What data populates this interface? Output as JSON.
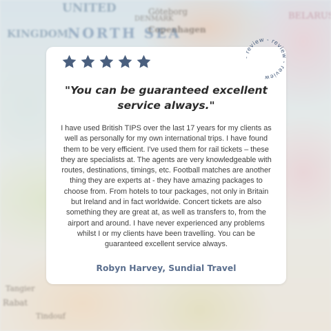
{
  "background": {
    "type": "map",
    "labels": [
      "UNITED",
      "KINGDOM",
      "NORTH SEA",
      "Göteborg",
      "Copenhagen",
      "DENMARK",
      "BELARUS",
      "Rabat",
      "Tangier",
      "Tindouf"
    ]
  },
  "rating": {
    "stars": 5,
    "max": 5,
    "color": "#4a5f7e"
  },
  "badge": {
    "text": "- review - review - review "
  },
  "review": {
    "quote": "\"You can be guaranteed excellent service always.\"",
    "body": "I have used British TIPS over the last 17 years for my clients as well as personally for my own international trips. I have found them to be very efficient. I've used them for rail tickets – these they are specialists at. The agents are very knowledgeable with routes, destinations, timings, etc. Football matches are another thing they are experts at - they have amazing packages to choose from. From hotels to tour packages, not only in Britain but Ireland and in fact worldwide. Concert tickets are also something they are great at, as well as transfers to, from the airport and around. I have never experienced any problems whilst I or my clients have been travelling. You can be guaranteed excellent service always.",
    "author": "Robyn Harvey, Sundial Travel"
  },
  "colors": {
    "accent": "#4a5f7e",
    "author": "#5b6f8e",
    "card": "#ffffff"
  }
}
